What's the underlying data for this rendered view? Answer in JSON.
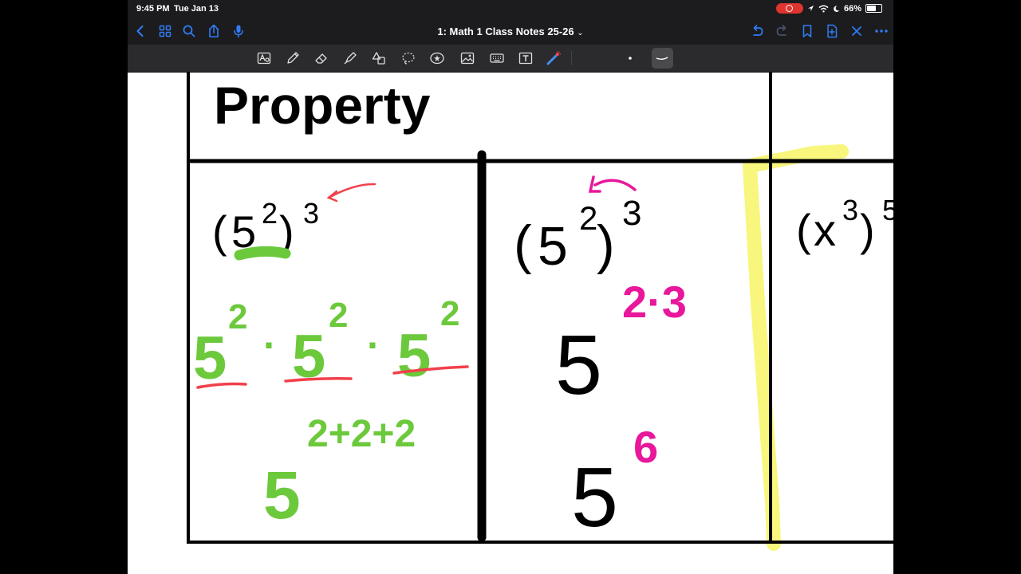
{
  "status_bar": {
    "time": "9:45 PM",
    "date": "Tue Jan 13",
    "battery": "66%"
  },
  "nav_bar": {
    "document_title": "1: Math 1 Class Notes 25-26",
    "left_icons": [
      "back-icon",
      "grid-icon",
      "search-icon",
      "share-icon",
      "microphone-icon"
    ],
    "right_icons": [
      "undo-icon",
      "redo-icon",
      "bookmark-icon",
      "add-page-icon",
      "close-icon",
      "more-icon"
    ]
  },
  "tool_bar": {
    "tools": [
      "lasso-text-icon",
      "pen-icon",
      "eraser-icon",
      "highlighter-icon",
      "shapes-icon",
      "lasso-icon",
      "sticker-icon",
      "image-icon",
      "keyboard-icon",
      "text-box-icon",
      "laser-pointer-icon"
    ],
    "options": [
      "dot-size-icon",
      "stroke-style-icon"
    ]
  },
  "page": {
    "heading": "Property",
    "col1": {
      "base": "5",
      "inner_exp": "2",
      "outer_exp": "3",
      "expanded": [
        "5",
        "2",
        "·",
        "5",
        "2",
        "·",
        "5",
        "2"
      ],
      "sum_base": "5",
      "sum_exp": "2+2+2"
    },
    "col2": {
      "base": "5",
      "inner_exp": "2",
      "outer_exp": "3",
      "product_base": "5",
      "product_exp": "2·3",
      "result_base": "5",
      "result_exp": "6"
    },
    "col3": {
      "base": "x",
      "inner_exp": "3",
      "outer_exp": "5"
    }
  },
  "colors": {
    "green": "#6cc93c",
    "pink": "#e8179b",
    "red": "#f2404a",
    "yellow": "#f7f56e",
    "ink": "#000000",
    "nav_bg": "#1c1c1e",
    "toolbar_bg": "#2b2b2d",
    "accent_blue": "#2f7cf6"
  }
}
